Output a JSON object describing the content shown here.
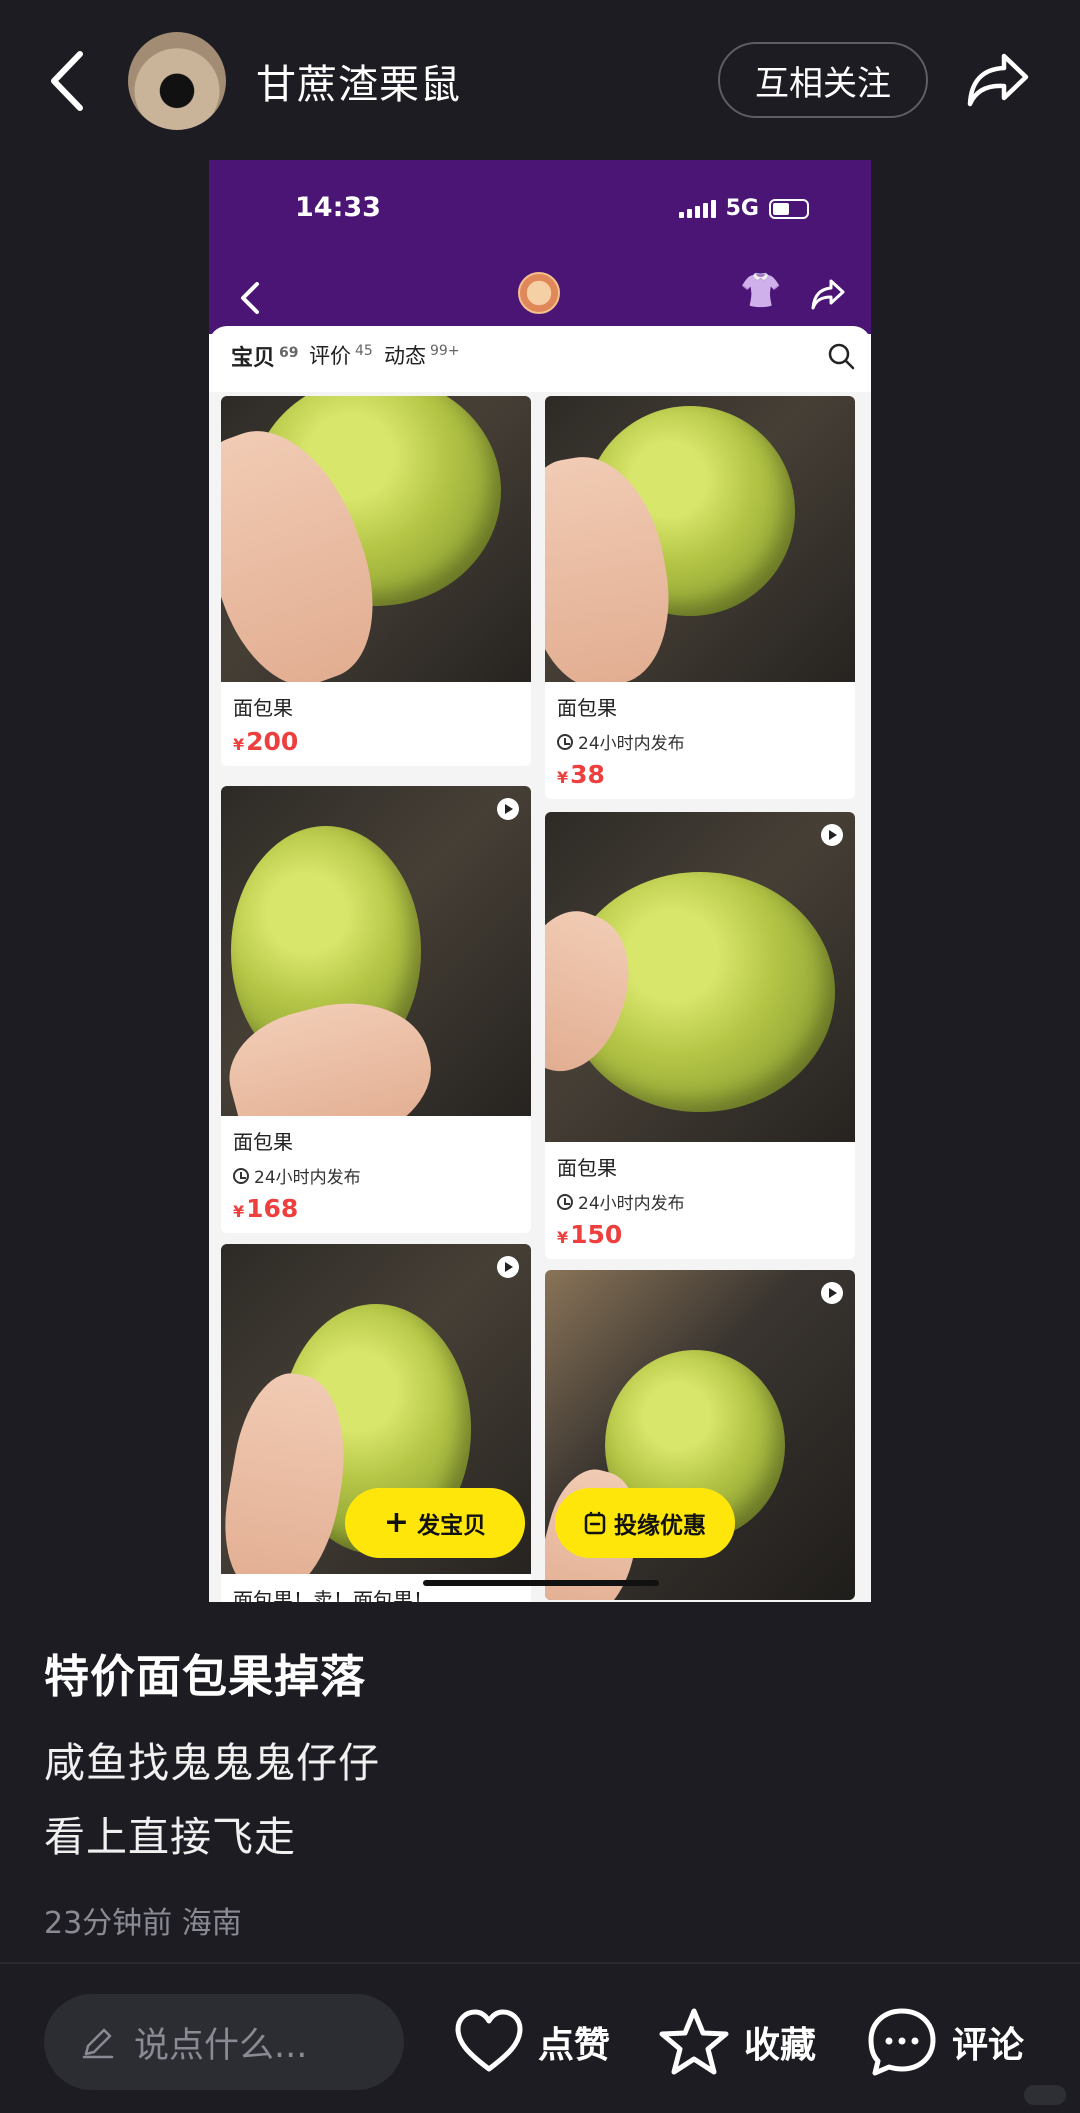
{
  "header": {
    "username": "甘蔗渣栗鼠",
    "follow_label": "互相关注"
  },
  "screenshot": {
    "time": "14:33",
    "network": "5G",
    "tabs": [
      {
        "label": "宝贝",
        "count": "69"
      },
      {
        "label": "评价",
        "count": "45"
      },
      {
        "label": "动态",
        "count": "99+"
      }
    ],
    "items": [
      {
        "title": "面包果",
        "badge": "",
        "currency": "¥",
        "price": "200"
      },
      {
        "title": "面包果",
        "badge": "24小时内发布",
        "currency": "¥",
        "price": "38"
      },
      {
        "title": "面包果",
        "badge": "24小时内发布",
        "currency": "¥",
        "price": "168"
      },
      {
        "title": "面包果",
        "badge": "24小时内发布",
        "currency": "¥",
        "price": "150"
      },
      {
        "title": "面包果！卖！面包果！",
        "badge": "",
        "currency": "",
        "price": ""
      }
    ],
    "fab_post": "发宝贝",
    "fab_promo": "投缘优惠",
    "dress_icon_color": "#ff8fd8",
    "accent_yellow": "#ffe60a",
    "header_purple": "#4a1574",
    "price_red": "#ee3f3f"
  },
  "post": {
    "title": "特价面包果掉落",
    "body_line1": "咸鱼找鬼鬼鬼仔仔",
    "body_line2": "看上直接飞走",
    "time_ago": "23分钟前",
    "location": "海南"
  },
  "bottom": {
    "comment_placeholder": "说点什么...",
    "like_label": "点赞",
    "collect_label": "收藏",
    "comment_label": "评论"
  }
}
